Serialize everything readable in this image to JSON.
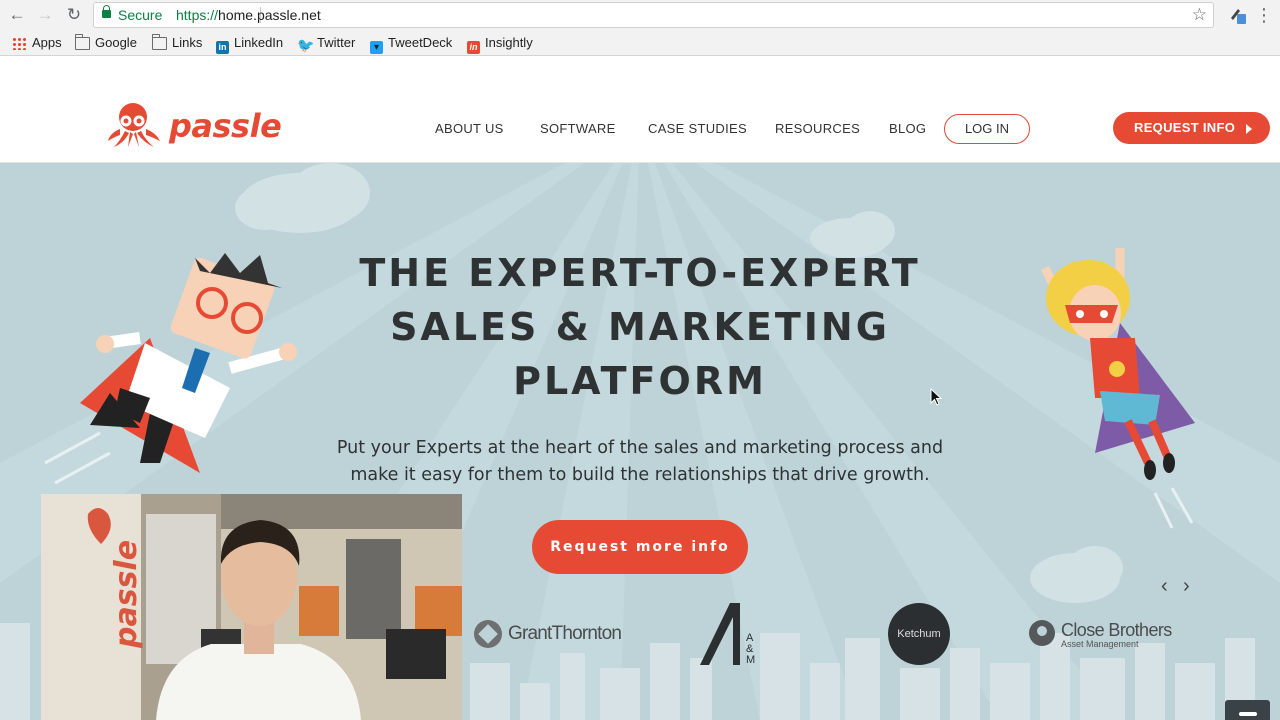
{
  "browser": {
    "secure_label": "Secure",
    "url_scheme": "https://",
    "url_host": "home.passle.net"
  },
  "bookmarks": [
    {
      "label": "Apps",
      "icon": "apps-grid-icon"
    },
    {
      "label": "Google",
      "icon": "folder-icon"
    },
    {
      "label": "Links",
      "icon": "folder-icon"
    },
    {
      "label": "LinkedIn",
      "icon": "linkedin-icon"
    },
    {
      "label": "Twitter",
      "icon": "twitter-icon"
    },
    {
      "label": "TweetDeck",
      "icon": "tweetdeck-icon"
    },
    {
      "label": "Insightly",
      "icon": "insightly-icon"
    }
  ],
  "header": {
    "logo_text": "passle",
    "nav": [
      "ABOUT US",
      "SOFTWARE",
      "CASE STUDIES",
      "RESOURCES",
      "BLOG"
    ],
    "login_label": "LOG IN",
    "request_info_label": "REQUEST INFO"
  },
  "hero": {
    "headline": [
      "THE EXPERT-TO-EXPERT",
      "SALES & MARKETING",
      "PLATFORM"
    ],
    "subtext": [
      "Put your Experts at the heart of the sales and marketing process and",
      "make it easy for them to build the relationships that drive growth."
    ],
    "cta_label": "Request more info"
  },
  "clients": {
    "grant_thornton": "GrantThornton",
    "am_letters": [
      "A",
      "&",
      "M"
    ],
    "ketchum": "Ketchum",
    "close_brothers": "Close Brothers",
    "close_brothers_sub": "Asset Management"
  },
  "video": {
    "wall_logo_text": "passle"
  },
  "colors": {
    "brand": "#e64a35",
    "hero_bg": "#bdd3d8",
    "text_dark": "#2f3233"
  }
}
